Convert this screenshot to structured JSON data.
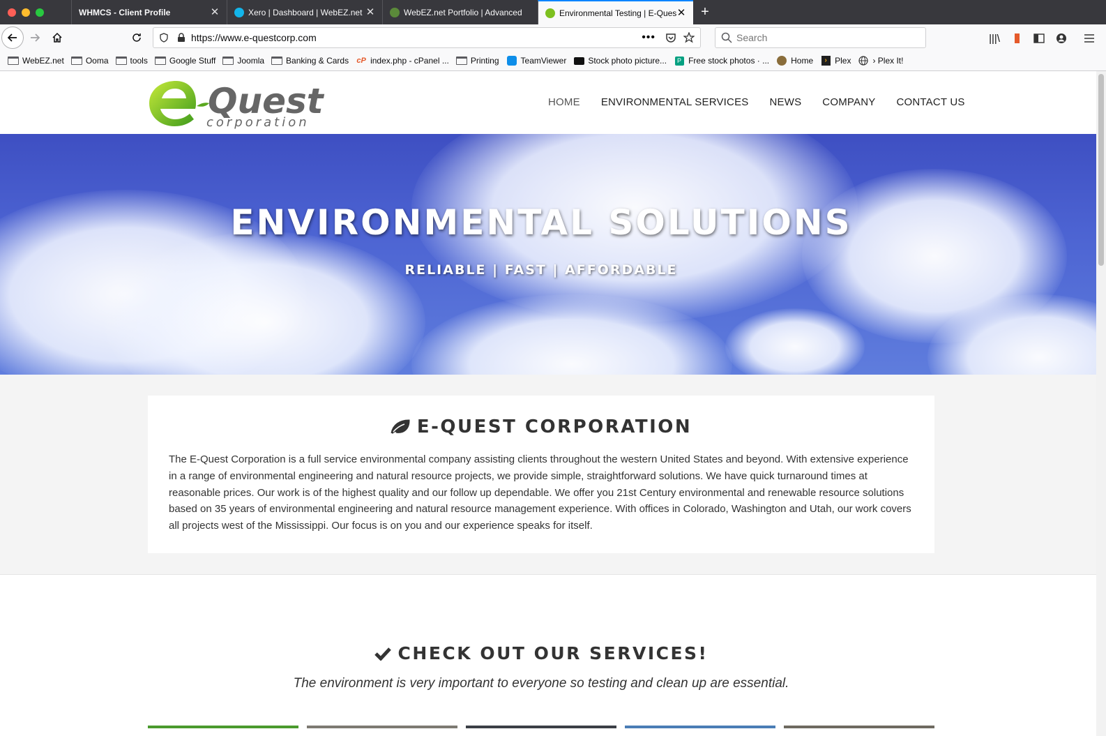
{
  "browser": {
    "tabs": [
      {
        "title": "WHMCS - Client Profile",
        "active": false
      },
      {
        "title": "Xero | Dashboard | WebEZ.net",
        "active": false
      },
      {
        "title": "WebEZ.net Portfolio | Advanced",
        "active": false
      },
      {
        "title": "Environmental Testing | E-Quest",
        "active": true
      }
    ],
    "url": "https://www.e-questcorp.com",
    "search_placeholder": "Search",
    "bookmarks": [
      {
        "label": "WebEZ.net",
        "icon": "folder-icon"
      },
      {
        "label": "Ooma",
        "icon": "folder-icon"
      },
      {
        "label": "tools",
        "icon": "folder-icon"
      },
      {
        "label": "Google Stuff",
        "icon": "folder-icon"
      },
      {
        "label": "Joomla",
        "icon": "folder-icon"
      },
      {
        "label": "Banking & Cards",
        "icon": "folder-icon"
      },
      {
        "label": "index.php - cPanel ...",
        "icon": "cpanel-icon"
      },
      {
        "label": "Printing",
        "icon": "folder-icon"
      },
      {
        "label": "TeamViewer",
        "icon": "teamviewer-icon"
      },
      {
        "label": "Stock photo picture...",
        "icon": "camera-icon"
      },
      {
        "label": "Free stock photos · ...",
        "icon": "pexels-icon"
      },
      {
        "label": "Home",
        "icon": "home-site-icon"
      },
      {
        "label": "Plex",
        "icon": "plex-icon"
      },
      {
        "label": "› Plex It!",
        "icon": "globe-icon"
      }
    ],
    "colors": {
      "accent": "#0a84ff",
      "tabbar": "#38383d"
    }
  },
  "site": {
    "logo": {
      "big": "Quest",
      "small": "corporation"
    },
    "nav": [
      "HOME",
      "ENVIRONMENTAL SERVICES",
      "NEWS",
      "COMPANY",
      "CONTACT US"
    ],
    "hero": {
      "title": "ENVIRONMENTAL SOLUTIONS",
      "subtitle": "RELIABLE | FAST | AFFORDABLE"
    },
    "about": {
      "title": "E-QUEST CORPORATION",
      "text": "The E-Quest Corporation is a full service environmental company assisting clients throughout the western United States and beyond. With extensive experience in a range of environmental engineering and natural resource projects, we provide simple, straightforward solutions. We have quick turnaround times at reasonable prices. Our work is of the highest quality and our follow up dependable. We offer you 21st Century environmental and renewable resource solutions based on 35 years of environmental engineering and natural resource management experience. With offices in Colorado, Washington and Utah, our work covers all projects west of the Mississippi. Our focus is on you and our experience speaks for itself."
    },
    "services": {
      "title": "CHECK OUT OUR SERVICES!",
      "subtitle": "The environment is very important to everyone so testing and clean up are essential."
    },
    "colors": {
      "brand_green": "#7dc01f",
      "text": "#333333",
      "sky": "#4c63d2"
    }
  }
}
